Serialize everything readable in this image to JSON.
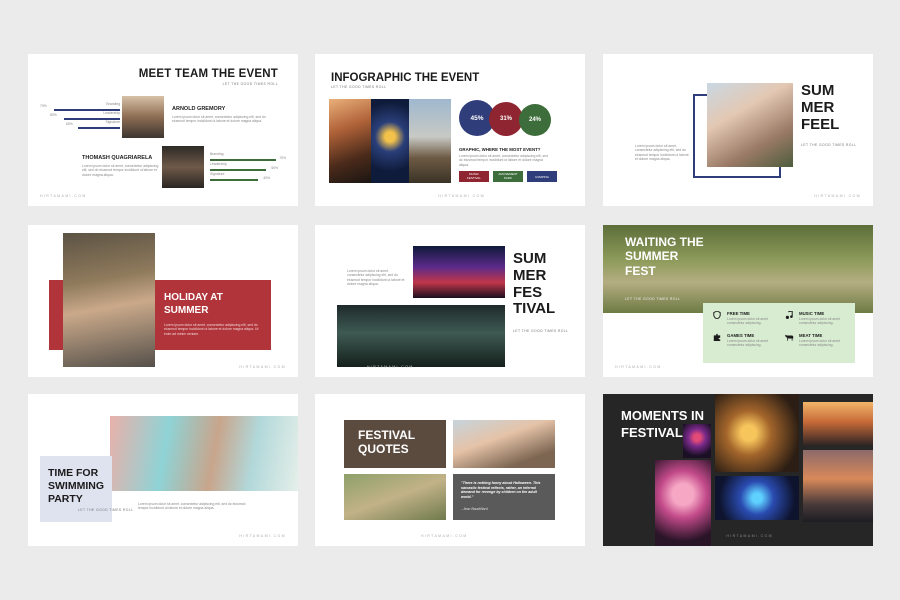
{
  "slides": {
    "s1": {
      "title": "MEET TEAM THE EVENT",
      "subtitle": "LET THE GOOD TIMES ROLL",
      "person1": {
        "name": "ARNOLD GREMORY",
        "desc": "Lorem ipsum dolor sit amet, consectetur adipiscing elit, sed do eiusmod tempor incididunt ut labore et dolore magna aliqua."
      },
      "person2": {
        "name": "THOMASH QUAGRIARELA",
        "desc": "Lorem ipsum dolor sit amet, consectetur adipiscing elit, sed do eiusmod tempor incididunt ut labore et dolore magna aliqua."
      },
      "skills1": [
        {
          "label": "Branding",
          "pct": "70%",
          "value": 0.7
        },
        {
          "label": "Leadership",
          "pct": "80%",
          "value": 0.8
        },
        {
          "label": "Signature",
          "pct": "60%",
          "value": 0.6
        }
      ],
      "skills2": [
        {
          "label": "Branding",
          "pct": "70%",
          "value": 0.7
        },
        {
          "label": "Leadership",
          "pct": "50%",
          "value": 0.5
        },
        {
          "label": "Signature",
          "pct": "40%",
          "value": 0.4
        }
      ],
      "footer": "HIRTAMAMI.COM"
    },
    "s2": {
      "title": "INFOGRAPHIC THE EVENT",
      "subtitle": "LET THE GOOD TIMES ROLL",
      "circles": [
        {
          "label": "45%",
          "color": "#2f3d7a"
        },
        {
          "label": "31%",
          "color": "#8e2530"
        },
        {
          "label": "24%",
          "color": "#3d6d3a"
        }
      ],
      "question": "GRAPHIC, WHERE THE MOST EVENT?",
      "desc": "Lorem ipsum dolor sit amet, consectetur adipiscing elit, sed do eiusmod tempor incididunt ut labore et dolore magna aliqua.",
      "tags": [
        {
          "label": "MUSIC FESTIVAL",
          "color": "#8e2530"
        },
        {
          "label": "AMUSEMENT PARK",
          "color": "#3d6d3a"
        },
        {
          "label": "CAMPING",
          "color": "#2f3d7a"
        }
      ],
      "footer": "HIRTAMAMI.COM"
    },
    "s3": {
      "title": "SUM MER FEEL",
      "subtitle": "LET THE GOOD TIMES ROLL",
      "desc": "Lorem ipsum dolor sit amet, consectetur adipiscing elit, sed do eiusmod tempor incididunt ut labore et dolore magna aliqua.",
      "footer": "HIRTAMAMI.COM"
    },
    "s4": {
      "title": "HOLIDAY AT SUMMER",
      "subtitle": "LET THE GOOD TIMES ROLL",
      "desc": "Lorem ipsum dolor sit amet, consectetur adipiscing elit, sed do eiusmod tempor incididunt ut labore et dolore magna aliqua. Ut enim ad minim veniam.",
      "footer": "HIRTAMAMI.COM"
    },
    "s5": {
      "title": "SUM MER FES TIVAL",
      "subtitle": "LET THE GOOD TIMES ROLL",
      "desc": "Lorem ipsum dolor sit amet, consectetur adipiscing elit, sed do eiusmod tempor incididunt ut labore et dolore magna aliqua.",
      "footer": "HIRTAMAMI.COM"
    },
    "s6": {
      "title": "WAITING THE SUMMER FEST",
      "subtitle": "LET THE GOOD TIMES ROLL",
      "items": [
        {
          "label": "FREE TIME",
          "icon": "shield-icon",
          "desc": "Lorem ipsum dolor sit amet consectetur adipiscing."
        },
        {
          "label": "MUSIC TIME",
          "icon": "music-note-icon",
          "desc": "Lorem ipsum dolor sit amet consectetur adipiscing."
        },
        {
          "label": "GAMES TIME",
          "icon": "puzzle-icon",
          "desc": "Lorem ipsum dolor sit amet consectetur adipiscing."
        },
        {
          "label": "MEAT TIME",
          "icon": "cow-icon",
          "desc": "Lorem ipsum dolor sit amet consectetur adipiscing."
        }
      ],
      "footer": "HIRTAMAMI.COM"
    },
    "s7": {
      "title": "TIME FOR SWIMMING PARTY",
      "subtitle": "LET THE GOOD TIMES ROLL",
      "desc": "Lorem ipsum dolor sit amet, consectetur adipiscing elit, sed do eiusmod tempor incididunt ut labore et dolore magna aliqua.",
      "footer": "HIRTAMAMI.COM"
    },
    "s8": {
      "title": "FESTIVAL QUOTES",
      "quote": "\"There is nothing funny about Halloween. This sarcastic festival reflects, rather, an infernal demand for revenge by children on the adult world.\"",
      "author": "- Jean Baudrillard",
      "footer": "HIRTAMAMI.COM"
    },
    "s9": {
      "title": "MOMENTS IN FESTIVAL",
      "footer": "HIRTAMAMI.COM"
    }
  },
  "colors": {
    "background": "#ebebeb",
    "navy": "#2f3d7a",
    "red": "#8e2530",
    "green": "#3d6d3a",
    "holiday_red": "#b0343a",
    "mint": "#d8ecd2",
    "lavender": "#dfe2ef",
    "dark": "#262626"
  }
}
